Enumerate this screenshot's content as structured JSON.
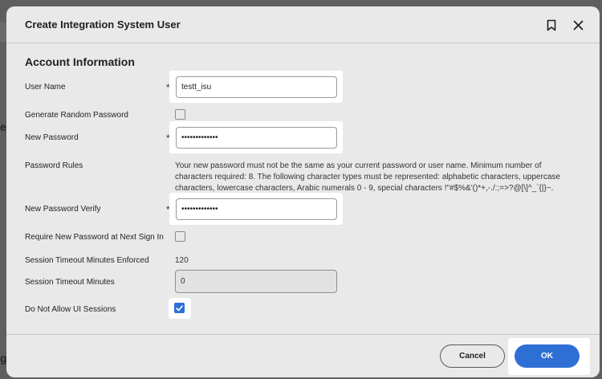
{
  "background": {
    "frag_left_mid": "e",
    "frag_left_bottom": "g"
  },
  "dialog": {
    "title": "Create Integration System User",
    "bookmark_icon": "bookmark-icon",
    "close_icon": "close-icon"
  },
  "section": {
    "title": "Account Information"
  },
  "fields": {
    "user_name": {
      "label": "User Name",
      "required_mark": "*",
      "value": "testt_isu"
    },
    "generate_random_password": {
      "label": "Generate Random Password",
      "checked": false
    },
    "new_password": {
      "label": "New Password",
      "required_mark": "*",
      "value": "•••••••••••••"
    },
    "password_rules": {
      "label": "Password Rules",
      "text": "Your new password must not be the same as your current password or user name. Minimum number of characters required: 8. The following character types must be represented: alphabetic characters, uppercase characters, lowercase characters, Arabic numerals 0 - 9, special characters !\"#$%&'()*+,-./:;=>?@[\\]^_`{|}~."
    },
    "new_password_verify": {
      "label": "New Password Verify",
      "required_mark": "*",
      "value": "•••••••••••••"
    },
    "require_new_password": {
      "label": "Require New Password at Next Sign In",
      "checked": false
    },
    "session_timeout_enforced": {
      "label": "Session Timeout Minutes Enforced",
      "value": "120"
    },
    "session_timeout_minutes": {
      "label": "Session Timeout Minutes",
      "value": "0"
    },
    "do_not_allow_ui_sessions": {
      "label": "Do Not Allow UI Sessions",
      "checked": true
    }
  },
  "footer": {
    "cancel_label": "Cancel",
    "ok_label": "OK"
  },
  "colors": {
    "accent": "#2e6fd6",
    "dialog_bg": "#e9e9e9",
    "overlay": "#5f5f5f"
  }
}
